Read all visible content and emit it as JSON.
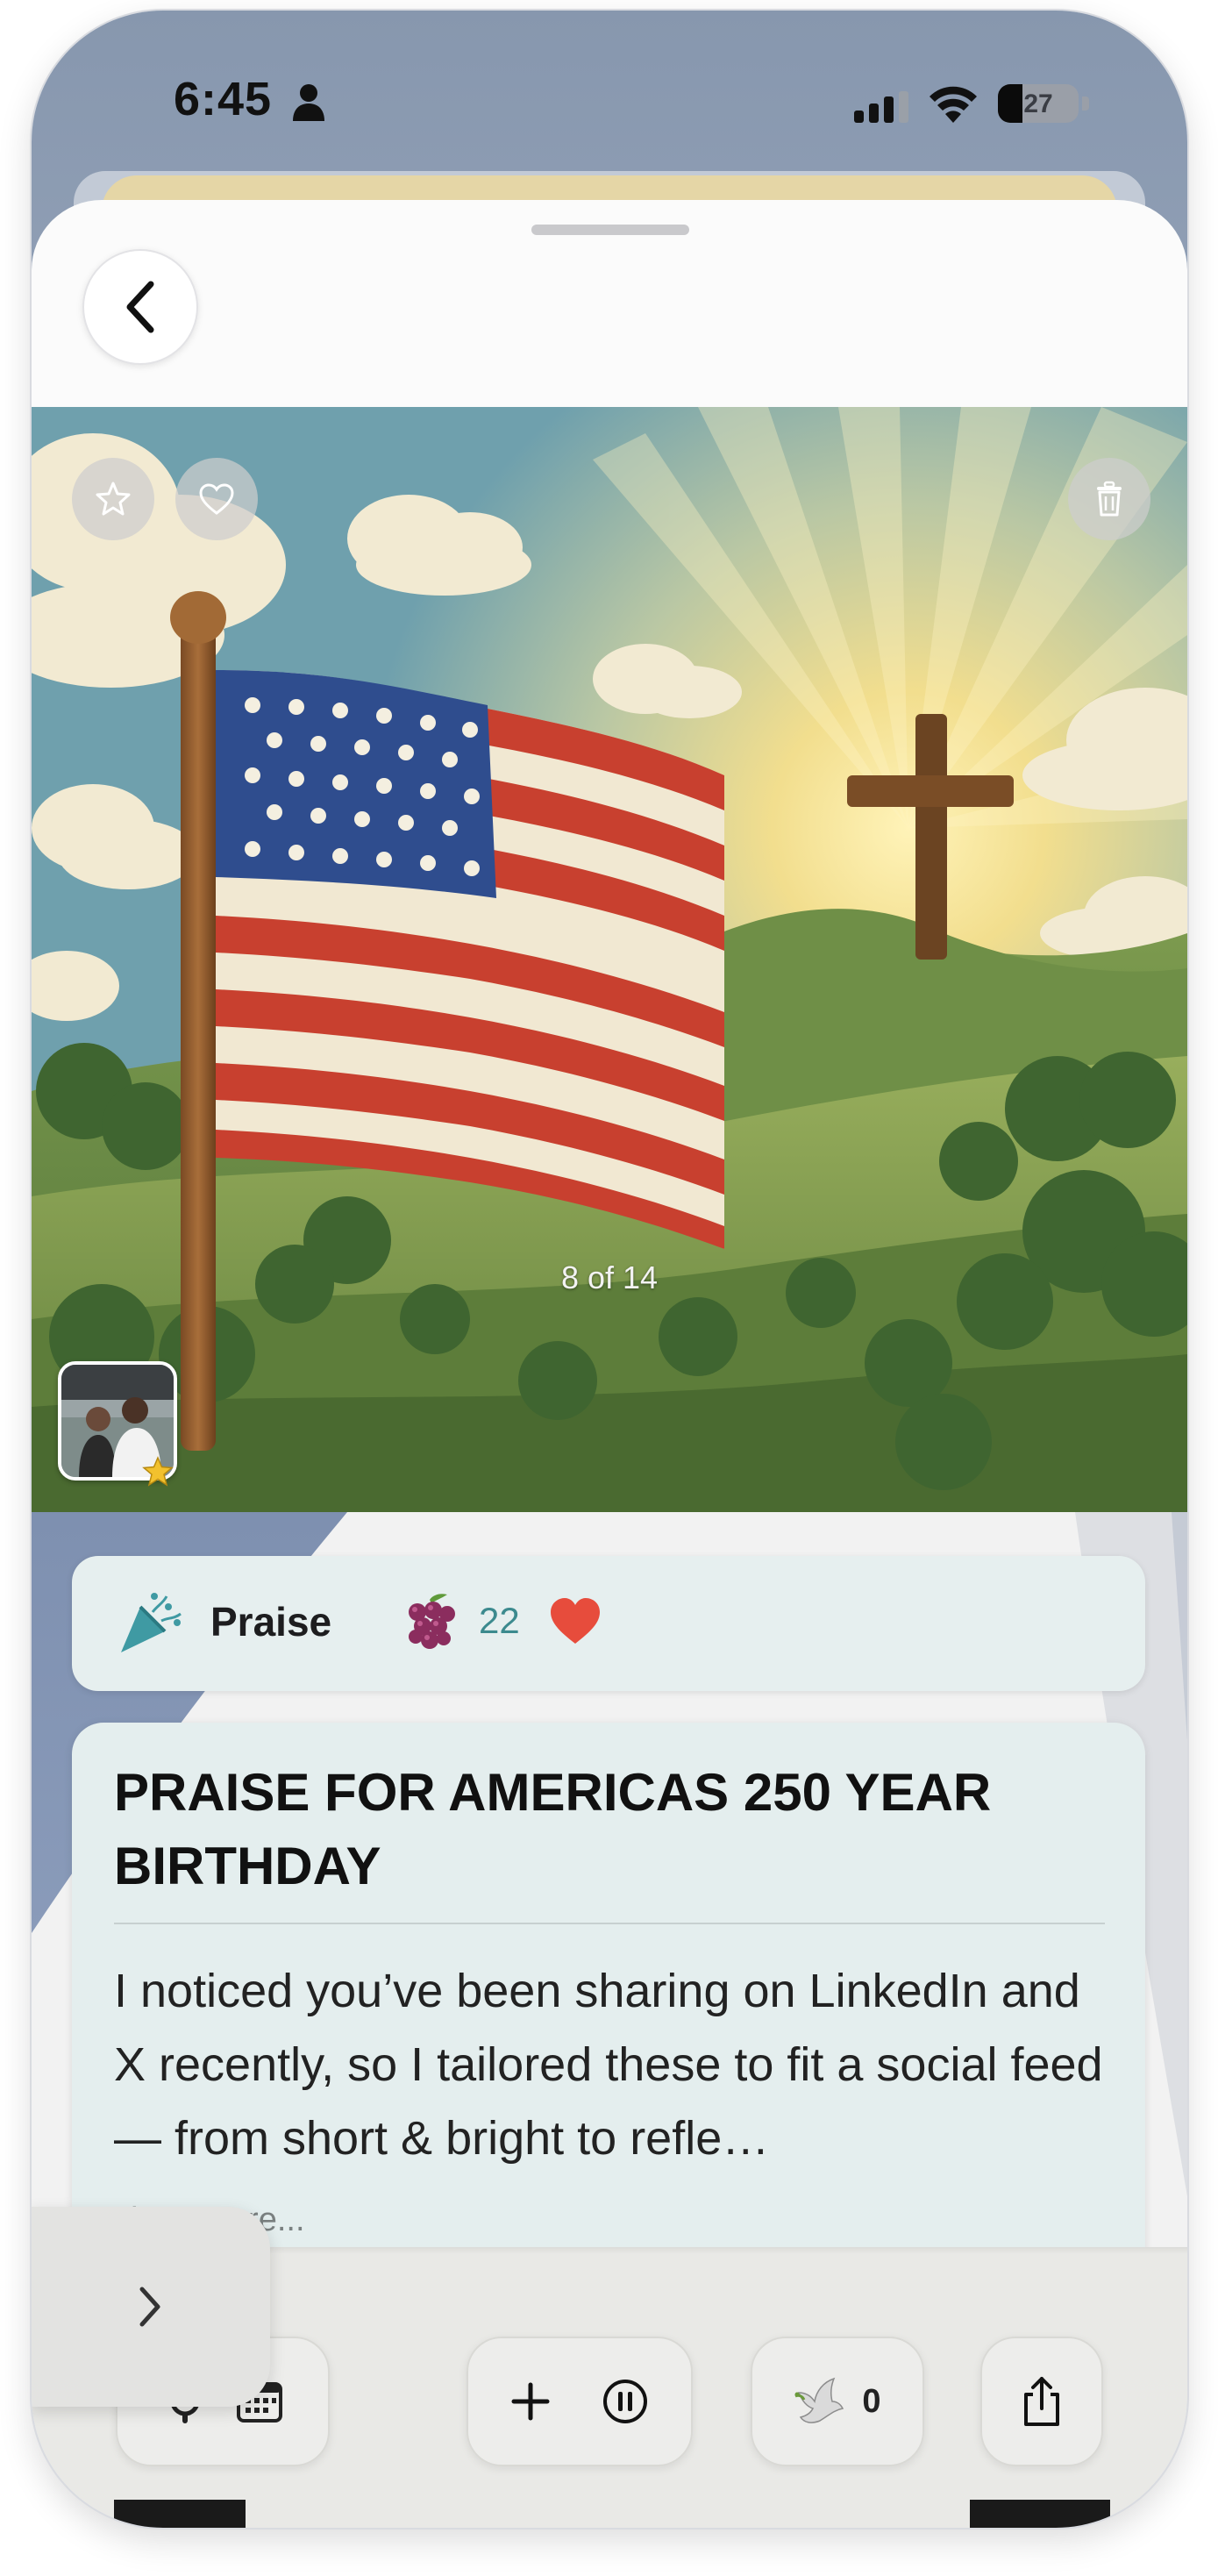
{
  "status_bar": {
    "time": "6:45",
    "battery_level": "27",
    "icons": [
      "person-icon",
      "signal-icon",
      "wifi-icon",
      "battery-icon"
    ]
  },
  "viewer": {
    "counter_text": "8 of 14",
    "top_left_buttons": [
      "star-icon",
      "heart-outline-icon"
    ],
    "top_right_buttons": [
      "trash-icon"
    ]
  },
  "category": {
    "icon": "party-popper-icon",
    "label": "Praise",
    "fruit_icon": "grapes-icon",
    "count": "22",
    "heart_icon": "heart-icon"
  },
  "post": {
    "title": "PRAISE FOR AMERICAS 250 YEAR BIRTHDAY",
    "body": "I noticed you’ve been sharing on LinkedIn and X recently, so I tailored these to fit a social feed — from short & bright to refle…",
    "show_more_label": "show more..."
  },
  "toolbar": {
    "dove_count": "0",
    "icons": [
      "chevron-right-icon",
      "gear-icon",
      "calendar-icon",
      "plus-icon",
      "pause-icon",
      "dove-icon",
      "share-icon"
    ]
  },
  "colors": {
    "accent_teal": "#3c8a8e",
    "heart_red": "#e74c3c",
    "card_bg": "#e4eeee",
    "sheet_bg": "#fbfbfb"
  }
}
